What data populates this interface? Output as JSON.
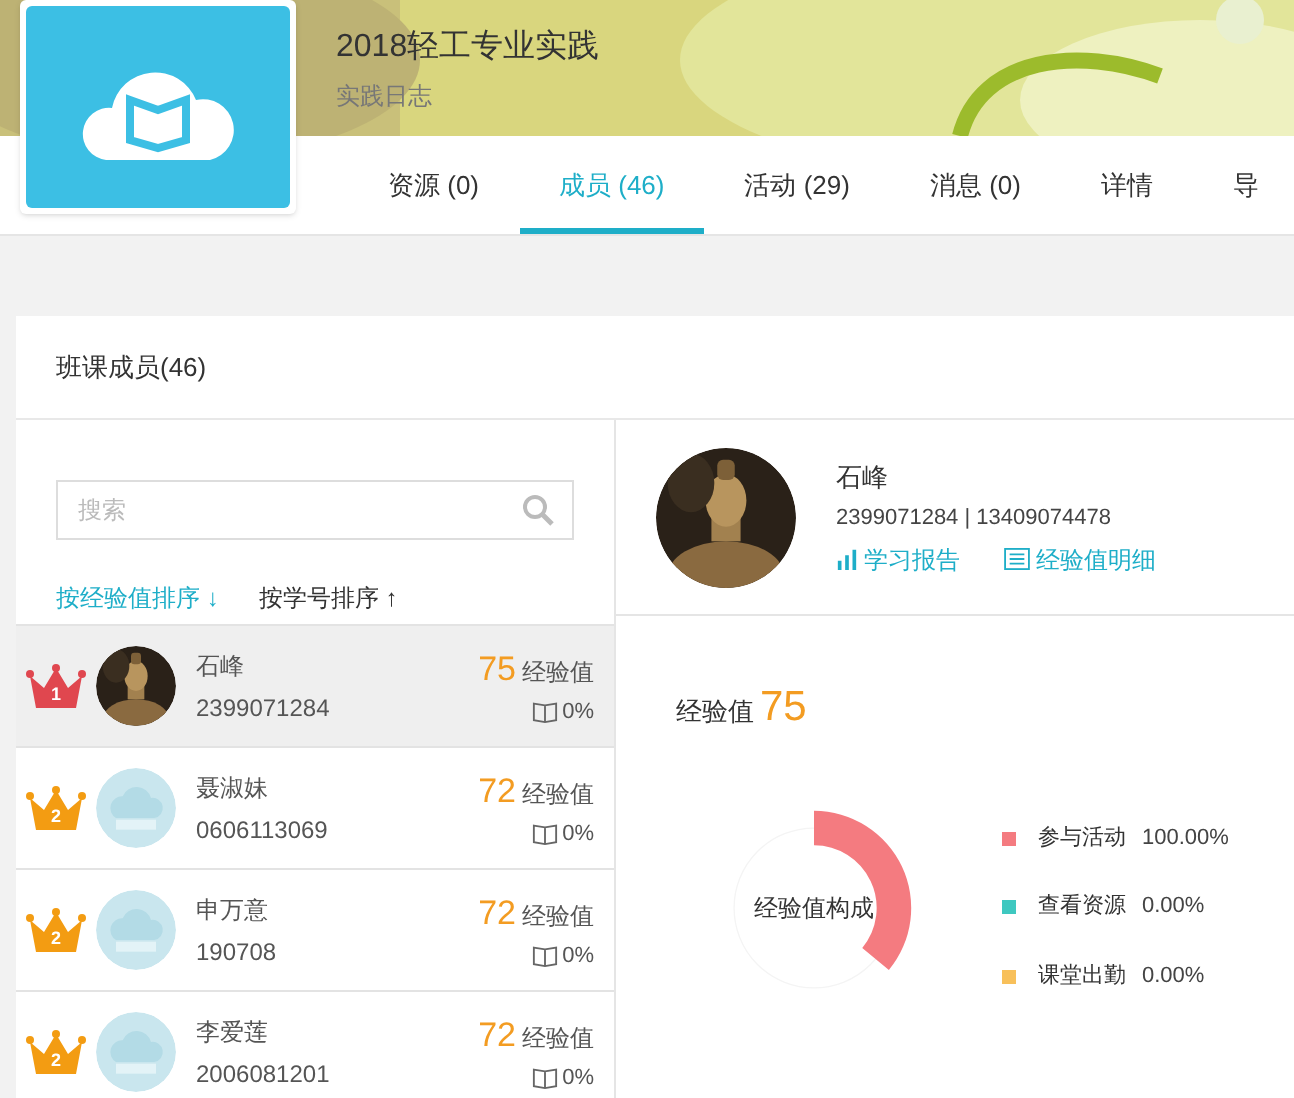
{
  "course": {
    "title": "2018轻工专业实践",
    "subtitle": "实践日志"
  },
  "tabs": [
    {
      "label": "资源 (0)",
      "selected": false
    },
    {
      "label": "成员 (46)",
      "selected": true
    },
    {
      "label": "活动 (29)",
      "selected": false
    },
    {
      "label": "消息 (0)",
      "selected": false
    },
    {
      "label": "详情",
      "selected": false
    },
    {
      "label": "导",
      "selected": false
    }
  ],
  "panel_title": "班课成员(46)",
  "search": {
    "placeholder": "搜索"
  },
  "sorts": [
    {
      "label": "按经验值排序",
      "arrow": "↓",
      "selected": true
    },
    {
      "label": "按学号排序",
      "arrow": "↑",
      "selected": false
    }
  ],
  "members": [
    {
      "rank": "1",
      "color": "#e0474f",
      "kind": "picture",
      "name": "石峰",
      "id": "2399071284",
      "score": "75",
      "score_unit": "经验值",
      "progress": "0%",
      "selected": true
    },
    {
      "rank": "2",
      "color": "#f39c12",
      "kind": "default",
      "name": "聂淑妹",
      "id": "0606113069",
      "score": "72",
      "score_unit": "经验值",
      "progress": "0%",
      "selected": false
    },
    {
      "rank": "2",
      "color": "#f39c12",
      "kind": "default",
      "name": "申万意",
      "id": "190708",
      "score": "72",
      "score_unit": "经验值",
      "progress": "0%",
      "selected": false
    },
    {
      "rank": "2",
      "color": "#f39c12",
      "kind": "default",
      "name": "李爱莲",
      "id": "2006081201",
      "score": "72",
      "score_unit": "经验值",
      "progress": "0%",
      "selected": false
    }
  ],
  "profile": {
    "name": "石峰",
    "contact": "2399071284 | 13409074478",
    "links": [
      {
        "kind": "report",
        "label": "学习报告"
      },
      {
        "kind": "detail",
        "label": "经验值明细"
      }
    ]
  },
  "experience": {
    "label": "经验值",
    "value": "75",
    "donut_label": "经验值构成",
    "legend": [
      {
        "label": "参与活动",
        "percent": "100.00%",
        "color": "#f47b80"
      },
      {
        "label": "查看资源",
        "percent": "0.00%",
        "color": "#3ec8c0"
      },
      {
        "label": "课堂出勤",
        "percent": "0.00%",
        "color": "#f8c05a"
      }
    ]
  }
}
